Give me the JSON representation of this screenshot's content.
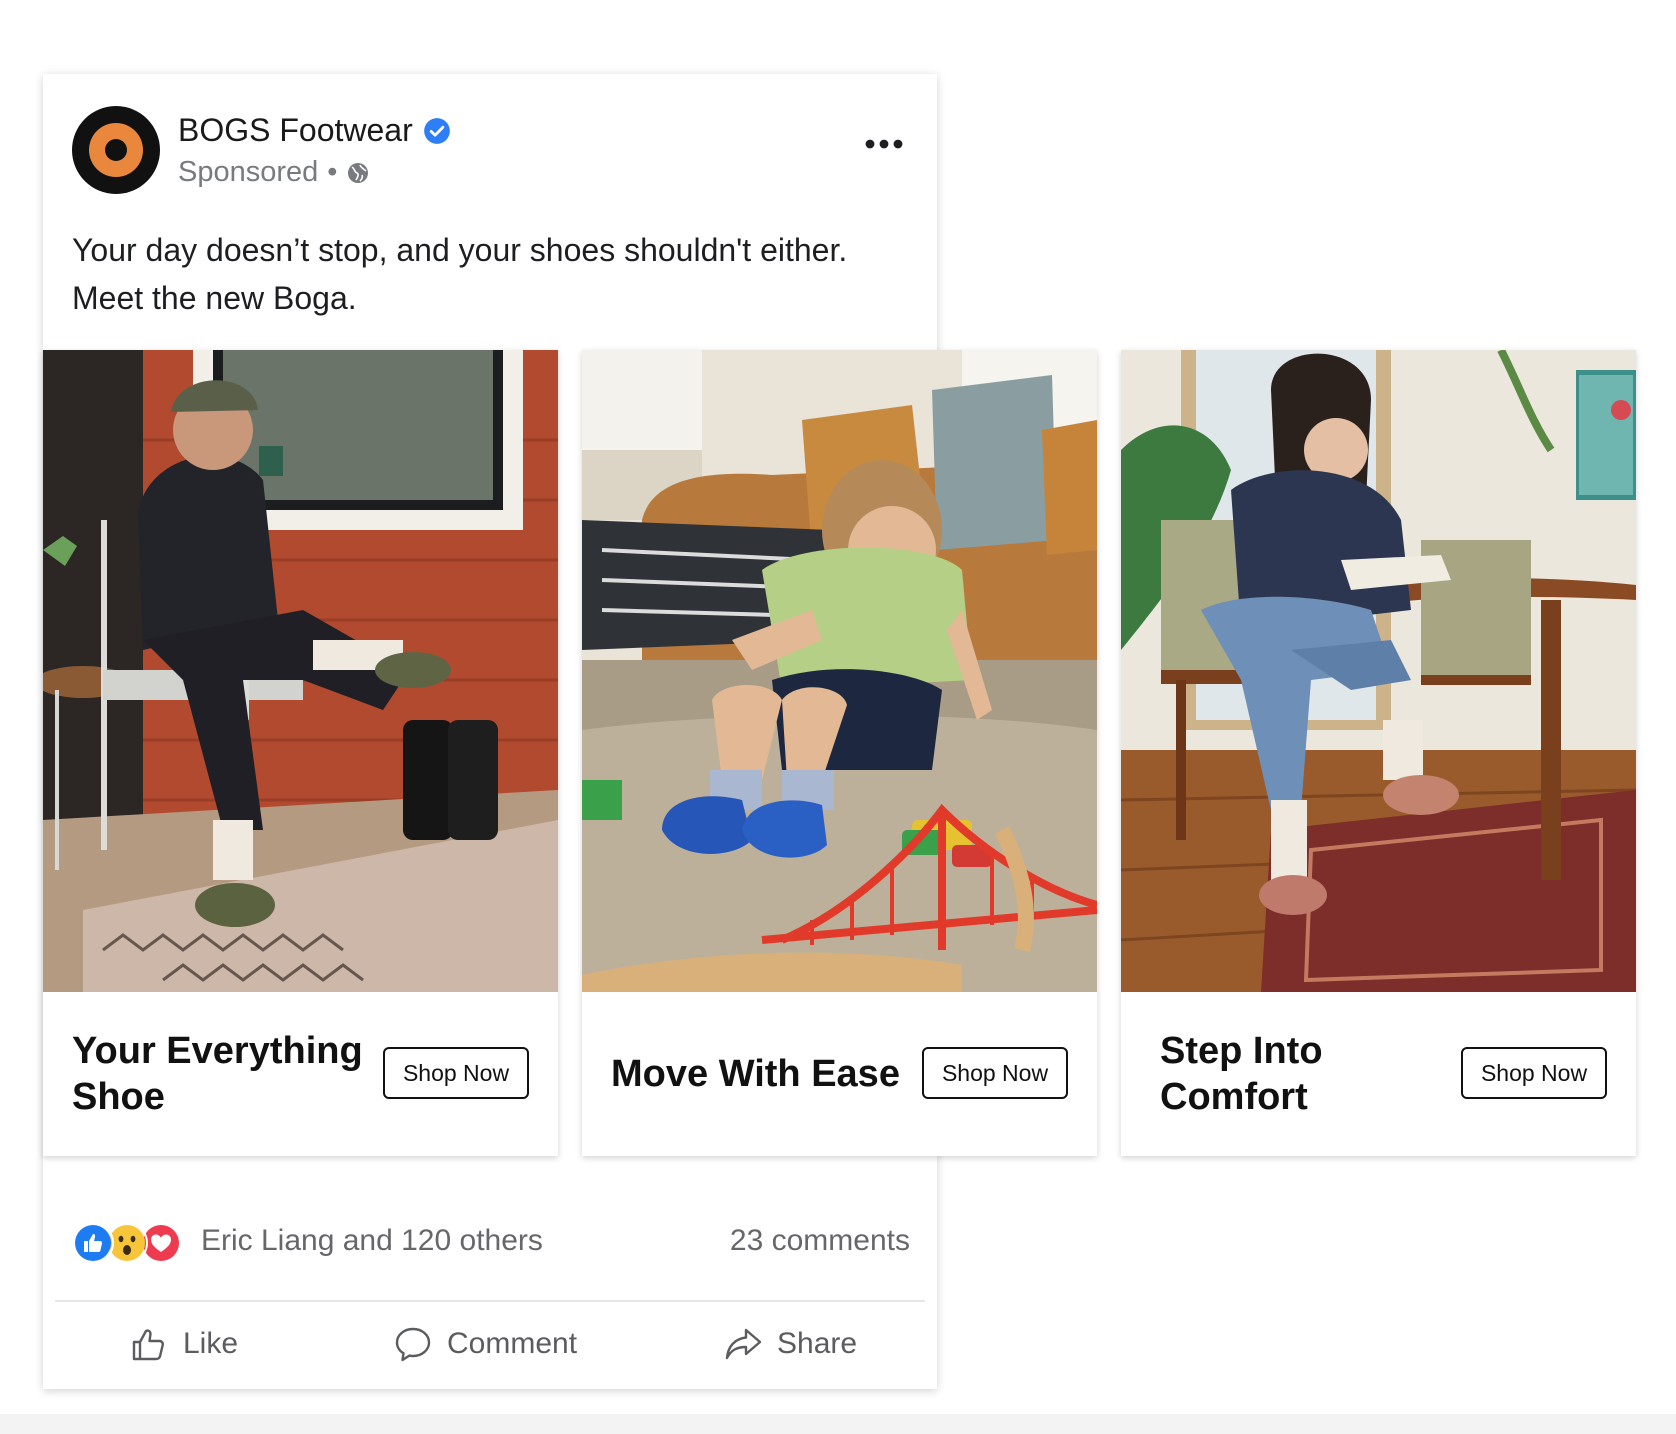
{
  "post": {
    "page_name": "BOGS Footwear",
    "sponsored_label": "Sponsored",
    "separator": "•",
    "body_text": "Your day doesn’t stop, and your shoes shouldn't either. Meet the new Boga.",
    "brand_colors": {
      "logo_ring": "#e9883c",
      "logo_dark": "#111111",
      "verified": "#2d7ef7"
    }
  },
  "carousel": {
    "cards": [
      {
        "headline": "Your Everything Shoe",
        "cta_label": "Shop Now"
      },
      {
        "headline": "Move With Ease",
        "cta_label": "Shop Now"
      },
      {
        "headline": "Step Into Comfort",
        "cta_label": "Shop Now"
      }
    ]
  },
  "engagement": {
    "reactions": [
      "like-icon",
      "wow-icon",
      "love-icon"
    ],
    "reactors_text": "Eric Liang and 120 others",
    "comments_text": "23 comments"
  },
  "actions": {
    "like_label": "Like",
    "comment_label": "Comment",
    "share_label": "Share"
  }
}
